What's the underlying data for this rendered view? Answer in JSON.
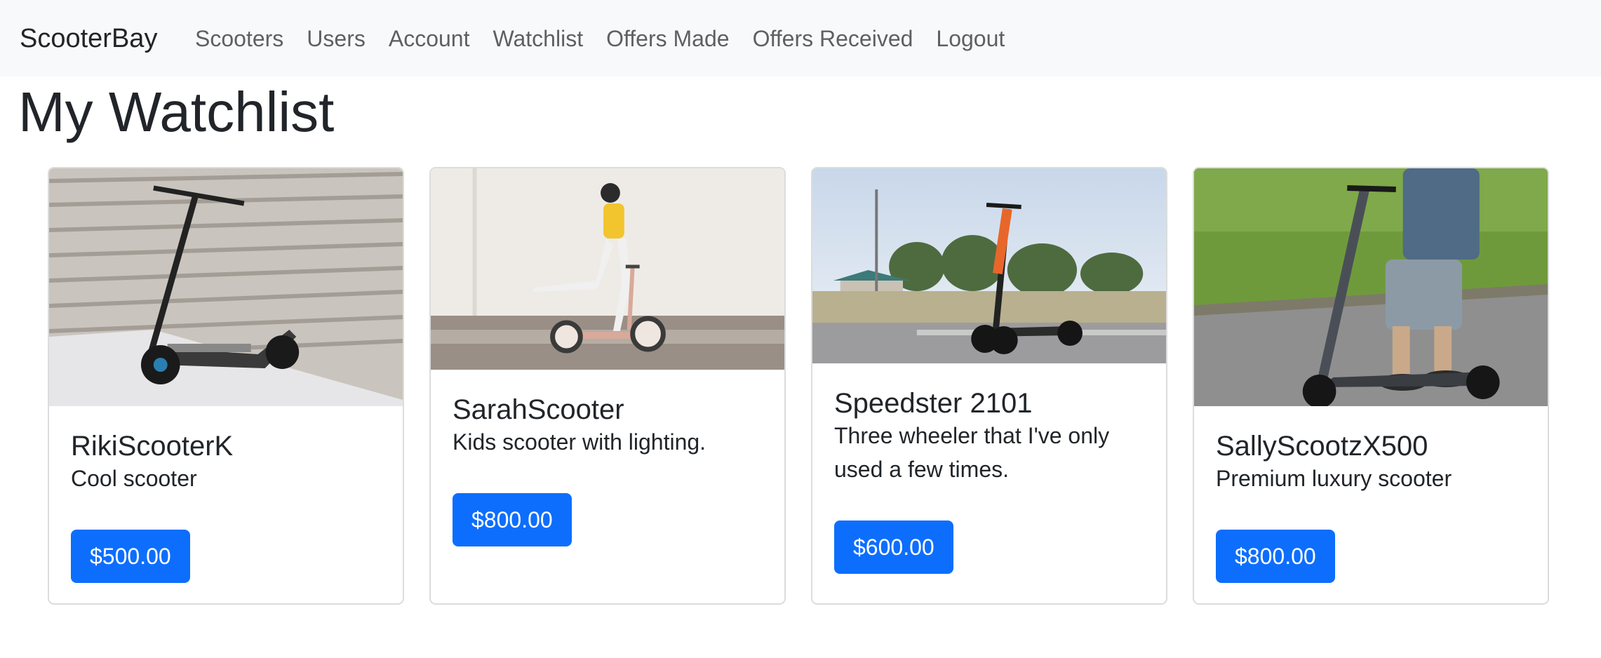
{
  "navbar": {
    "brand": "ScooterBay",
    "links": [
      "Scooters",
      "Users",
      "Account",
      "Watchlist",
      "Offers Made",
      "Offers Received",
      "Logout"
    ]
  },
  "page": {
    "title": "My Watchlist"
  },
  "cards": [
    {
      "title": "RikiScooterK",
      "description": "Cool scooter",
      "price": "$500.00"
    },
    {
      "title": "SarahScooter",
      "description": "Kids scooter with lighting.",
      "price": "$800.00"
    },
    {
      "title": "Speedster 2101",
      "description": "Three wheeler that I've only used a few times.",
      "price": "$600.00"
    },
    {
      "title": "SallyScootzX500",
      "description": "Premium luxury scooter",
      "price": "$800.00"
    }
  ],
  "colors": {
    "navbar_bg": "#f8f9fa",
    "primary_button": "#0d6efd",
    "text": "#212529",
    "nav_link": "rgba(0,0,0,0.62)"
  }
}
